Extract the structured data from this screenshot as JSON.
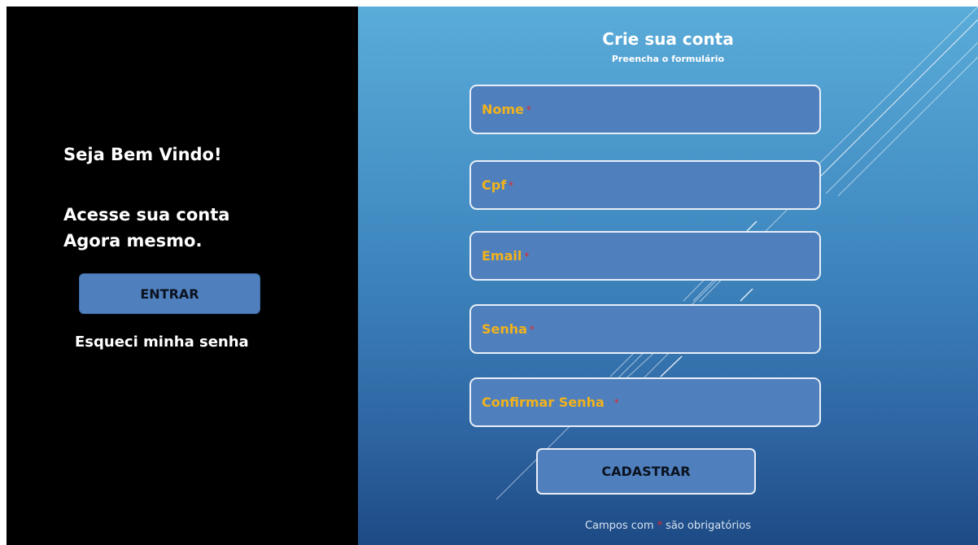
{
  "colors": {
    "left_bg": "#000000",
    "button_fill": "#4f80bd",
    "field_label": "#f2b21c",
    "required_marker": "#e4262b",
    "right_gradient_top": "#5aacd9",
    "right_gradient_bottom": "#1d4a85"
  },
  "login_panel": {
    "welcome": "Seja Bem Vindo!",
    "access_line1": "Acesse sua conta",
    "access_line2": "Agora mesmo.",
    "enter_label": "ENTRAR",
    "forgot_label": "Esqueci minha senha"
  },
  "signup": {
    "title": "Crie sua conta",
    "subtitle": "Preencha o formulário",
    "required_marker": "*",
    "fields": [
      {
        "label": "Nome"
      },
      {
        "label": "Cpf"
      },
      {
        "label": "Email"
      },
      {
        "label": "Senha"
      },
      {
        "label": "Confirmar Senha"
      }
    ],
    "submit_label": "CADASTRAR",
    "footnote_before": "Campos com",
    "footnote_after": "são obrigatórios"
  }
}
